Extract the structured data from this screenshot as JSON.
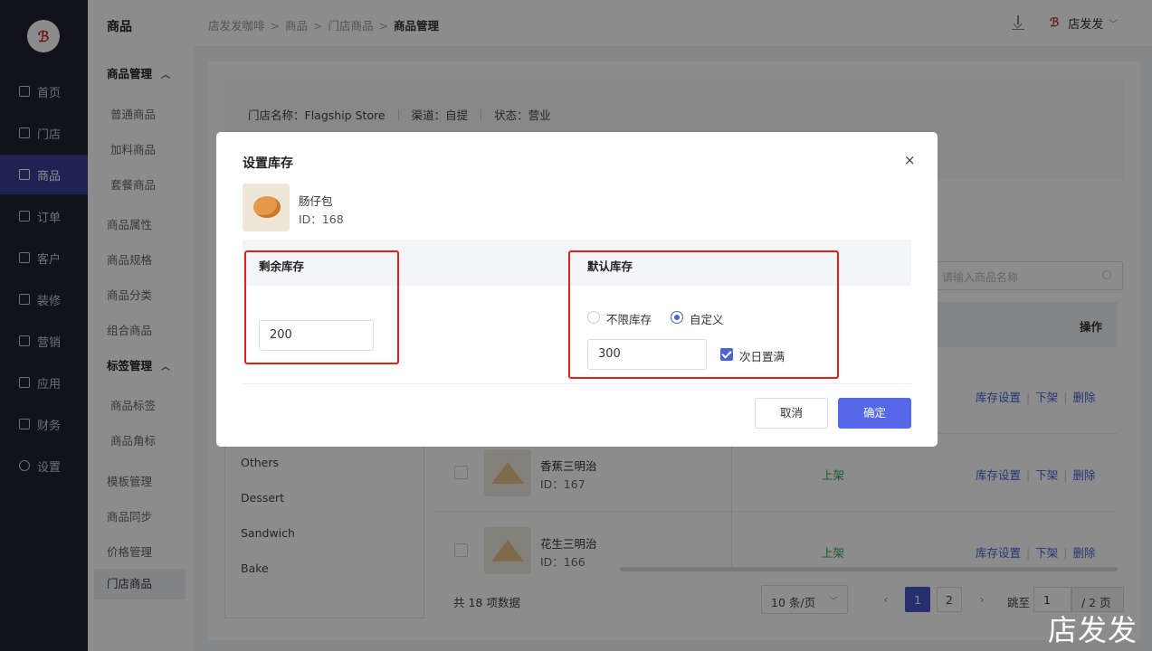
{
  "sidebar": {
    "logo": "ℬ",
    "items": [
      {
        "label": "首页"
      },
      {
        "label": "门店"
      },
      {
        "label": "商品"
      },
      {
        "label": "订单"
      },
      {
        "label": "客户"
      },
      {
        "label": "装修"
      },
      {
        "label": "营销"
      },
      {
        "label": "应用"
      },
      {
        "label": "财务"
      },
      {
        "label": "设置"
      }
    ]
  },
  "subnav": {
    "title": "商品",
    "groups": [
      {
        "label": "商品管理",
        "items": [
          "普通商品",
          "加料商品",
          "套餐商品"
        ]
      },
      {
        "label": "标签管理",
        "items": [
          "商品标签",
          "商品角标"
        ]
      }
    ],
    "items": [
      "商品属性",
      "商品规格",
      "商品分类",
      "组合商品",
      "模板管理",
      "商品同步",
      "价格管理",
      "门店商品"
    ]
  },
  "topbar": {
    "breadcrumb": [
      "店发发咖啡",
      "商品",
      "门店商品",
      "商品管理"
    ],
    "user": "店发发"
  },
  "info": {
    "store": "门店名称：Flagship Store",
    "channel": "渠道：自提",
    "status": "状态：营业"
  },
  "search": {
    "placeholder": "请输入商品名称"
  },
  "table": {
    "op_header": "操作",
    "categories": [
      "Others",
      "Dessert",
      "Sandwich",
      "Bake"
    ],
    "rows": [
      {
        "name": "",
        "id": "",
        "status": "",
        "ops": [
          "库存设置",
          "下架",
          "删除"
        ]
      },
      {
        "name": "香蕉三明治",
        "id": "ID：167",
        "status": "上架",
        "ops": [
          "库存设置",
          "下架",
          "删除"
        ]
      },
      {
        "name": "花生三明治",
        "id": "ID：166",
        "status": "上架",
        "ops": [
          "库存设置",
          "下架",
          "删除"
        ]
      }
    ]
  },
  "pagination": {
    "total": "共 18 项数据",
    "page_size": "10 条/页",
    "pages": [
      "1",
      "2"
    ],
    "jump_label": "跳至",
    "jump_value": "1",
    "total_pages": "/ 2 页"
  },
  "modal": {
    "title": "设置库存",
    "close": "×",
    "product_name": "肠仔包",
    "product_id": "ID：168",
    "remain_label": "剩余库存",
    "remain_value": "200",
    "default_label": "默认库存",
    "radio_unlimited": "不限库存",
    "radio_custom": "自定义",
    "custom_value": "300",
    "checkbox_label": "次日置满",
    "cancel": "取消",
    "ok": "确定"
  },
  "watermark": "店发发",
  "colors": {
    "accent": "#5468e8",
    "highlight": "#e0201d",
    "status_on": "#2aa45a",
    "sidebar_bg": "#1f2130"
  }
}
